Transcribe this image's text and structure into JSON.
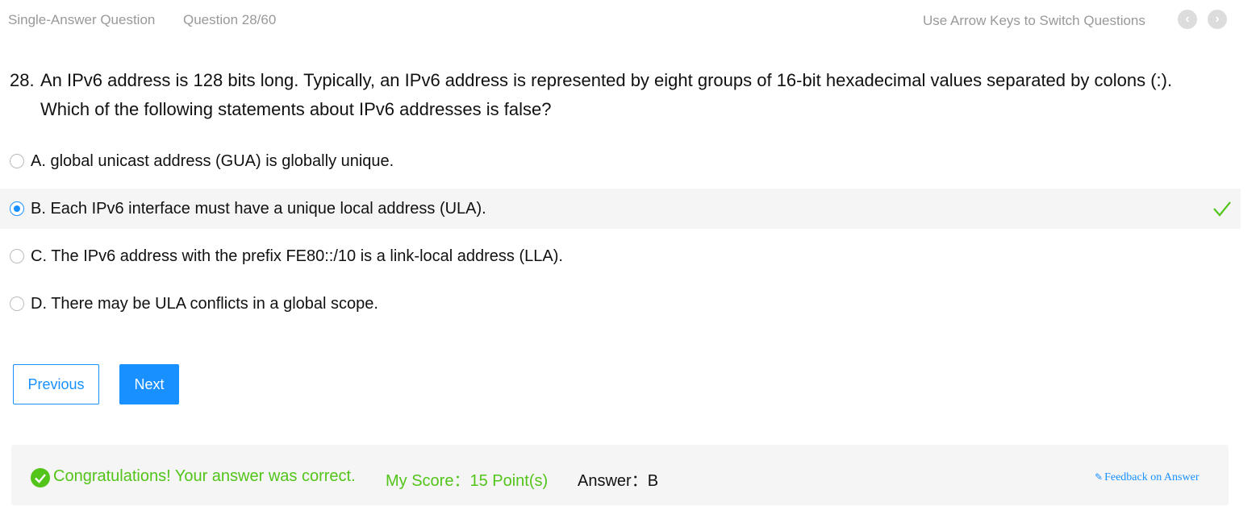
{
  "header": {
    "question_type": "Single-Answer Question",
    "question_counter": "Question 28/60",
    "hint": "Use Arrow Keys to Switch Questions",
    "prev_glyph": "‹",
    "next_glyph": "›"
  },
  "question": {
    "number": "28.",
    "text": "An IPv6 address is 128 bits long. Typically, an IPv6 address is represented by eight groups of 16-bit hexadecimal values separated by colons (:). Which of the following statements about IPv6 addresses is false?"
  },
  "options": [
    {
      "label": "A. global unicast address (GUA) is globally unique.",
      "selected": false
    },
    {
      "label": "B. Each IPv6 interface must have a unique local address (ULA).",
      "selected": true,
      "correct": true
    },
    {
      "label": "C. The IPv6 address with the prefix FE80::/10 is a link-local address (LLA).",
      "selected": false
    },
    {
      "label": "D. There may be ULA conflicts in a global scope.",
      "selected": false
    }
  ],
  "buttons": {
    "previous": "Previous",
    "next": "Next"
  },
  "result": {
    "message": "Congratulations! Your answer was correct.",
    "score": "My Score：15 Point(s)",
    "answer": "Answer：B",
    "feedback": "Feedback on Answer"
  },
  "colors": {
    "accent": "#1890ff",
    "success": "#52c41a",
    "muted": "#999999"
  }
}
